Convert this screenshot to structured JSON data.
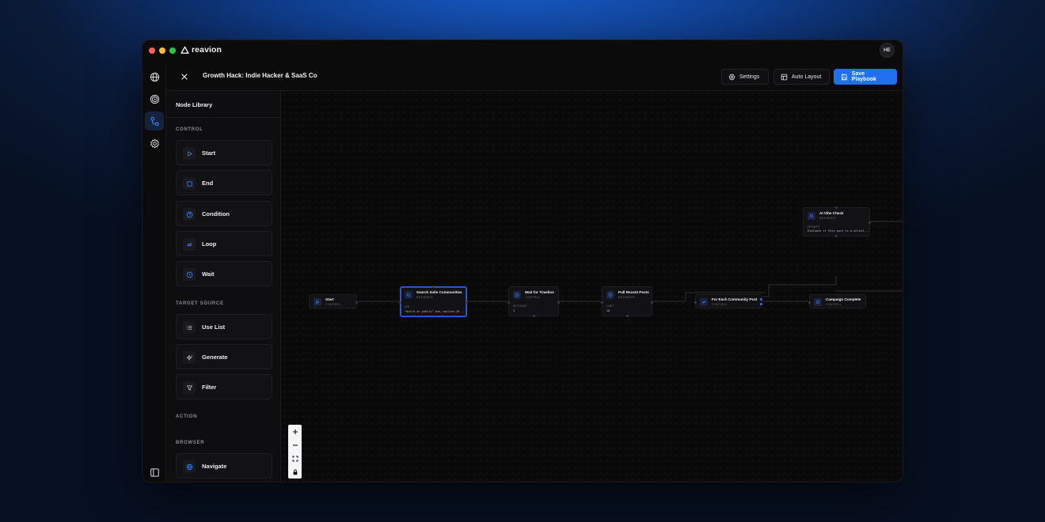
{
  "app": {
    "brand": "reavion",
    "avatar_initials": "HE"
  },
  "colors": {
    "accent": "#1f6ff0",
    "traffic_red": "#ff5f57",
    "traffic_yellow": "#febc2e",
    "traffic_green": "#28c840"
  },
  "rail": {
    "icons": [
      "globe-icon",
      "target-icon",
      "workflow-icon",
      "gear-icon"
    ],
    "active": "workflow-icon",
    "bottom_icon": "sidebar-toggle-icon"
  },
  "header": {
    "title": "Growth Hack: Indie Hacker & SaaS Co",
    "settings_label": "Settings",
    "auto_layout_label": "Auto Layout",
    "save_label": "Save Playbook"
  },
  "library": {
    "title": "Node Library",
    "sections": {
      "control": "CONTROL",
      "target_source": "TARGET SOURCE",
      "action": "ACTION",
      "browser": "BROWSER"
    },
    "control_items": [
      {
        "label": "Start",
        "icon": "play-icon"
      },
      {
        "label": "End",
        "icon": "square-icon"
      },
      {
        "label": "Condition",
        "icon": "question-icon"
      },
      {
        "label": "Loop",
        "icon": "loop-icon"
      },
      {
        "label": "Wait",
        "icon": "clock-icon"
      }
    ],
    "target_items": [
      {
        "label": "Use List",
        "icon": "list-icon"
      },
      {
        "label": "Generate",
        "icon": "sparkle-icon"
      },
      {
        "label": "Filter",
        "icon": "filter-icon"
      }
    ],
    "browser_items": [
      {
        "label": "Navigate",
        "icon": "globe-icon"
      }
    ]
  },
  "nodes": {
    "start": {
      "title": "Start",
      "type": "CONTROL"
    },
    "search": {
      "title": "Search Indie Communities",
      "type": "BROWSER",
      "param_label": "URL",
      "param_value": "\"build in public\" min_replies:10 ..."
    },
    "wait": {
      "title": "Wait for Timeline",
      "type": "CONTROL",
      "param_label": "SECONDS",
      "param_value": "3"
    },
    "pull": {
      "title": "Pull Recent Posts",
      "type": "BROWSER",
      "param_label": "LIMIT",
      "param_value": "10"
    },
    "foreach": {
      "title": "For Each Community Post",
      "type": "CONTROL"
    },
    "complete": {
      "title": "Campaign Complete",
      "type": "CONTROL"
    },
    "vibe": {
      "title": "AI Vibe Check",
      "type": "BROWSER",
      "param_label": "PROMPT",
      "param_value": "Evaluate if this post is a milest..."
    }
  },
  "zoom_controls": [
    "zoom-in-icon",
    "zoom-out-icon",
    "fit-view-icon",
    "lock-icon"
  ]
}
